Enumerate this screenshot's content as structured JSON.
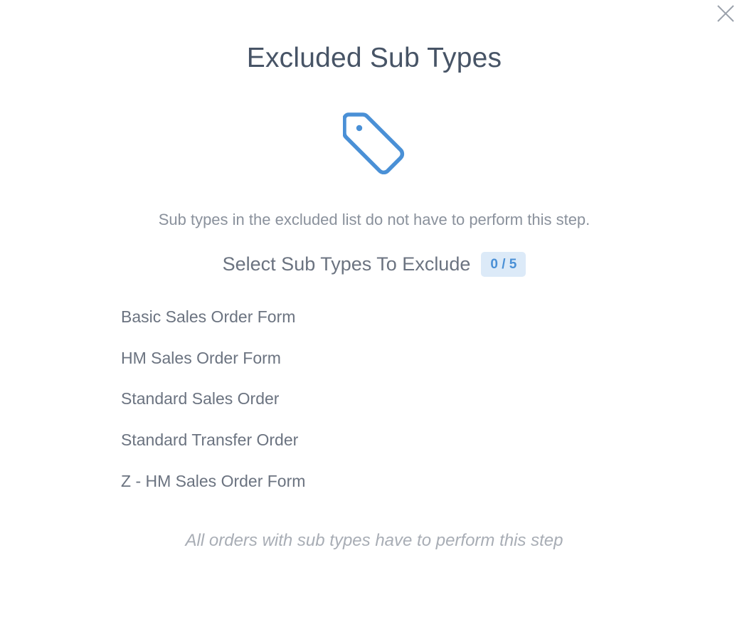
{
  "modal": {
    "title": "Excluded Sub Types",
    "icon": "tag-icon",
    "close_icon": "close-icon",
    "description": "Sub types in the excluded list do not have to perform this step.",
    "select_heading": "Select Sub Types To Exclude",
    "selected_count": "0 / 5",
    "sub_types": [
      "Basic Sales Order Form",
      "HM Sales Order Form",
      "Standard Sales Order",
      "Standard Transfer Order",
      "Z - HM Sales Order Form"
    ],
    "empty_note": "All orders with sub types have to perform this step"
  },
  "colors": {
    "accent": "#4a90d6",
    "badge_bg": "#dceaf8",
    "title": "#475466",
    "text": "#6b7380",
    "muted": "#a8adb5"
  }
}
